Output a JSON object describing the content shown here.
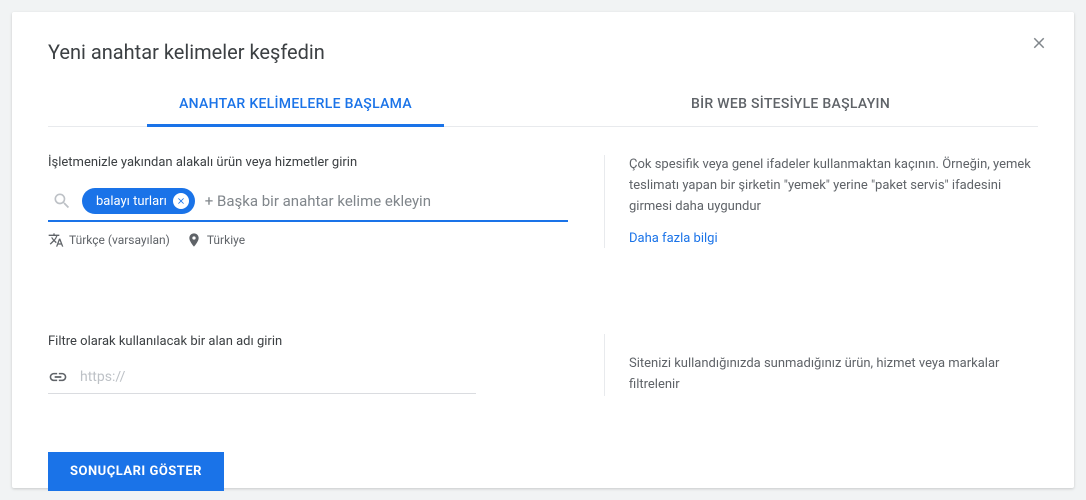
{
  "title": "Yeni anahtar kelimeler keşfedin",
  "tabs": {
    "keywords": "ANAHTAR KELİMELERLE BAŞLAMA",
    "website": "BİR WEB SİTESİYLE BAŞLAYIN"
  },
  "section1": {
    "label": "İşletmenizle yakından alakalı ürün veya hizmetler girin",
    "chip": "balayı turları",
    "placeholder": "+ Başka bir anahtar kelime ekleyin",
    "language": "Türkçe (varsayılan)",
    "location": "Türkiye",
    "help": "Çok spesifik veya genel ifadeler kullanmaktan kaçının. Örneğin, yemek teslimatı yapan bir şirketin \"yemek\" yerine \"paket servis\" ifadesini girmesi daha uygundur",
    "learnMore": "Daha fazla bilgi"
  },
  "section2": {
    "label": "Filtre olarak kullanılacak bir alan adı girin",
    "placeholder": "https://",
    "help": "Sitenizi kullandığınızda sunmadığınız ürün, hizmet veya markalar filtrelenir"
  },
  "resultsButton": "SONUÇLARI GÖSTER"
}
